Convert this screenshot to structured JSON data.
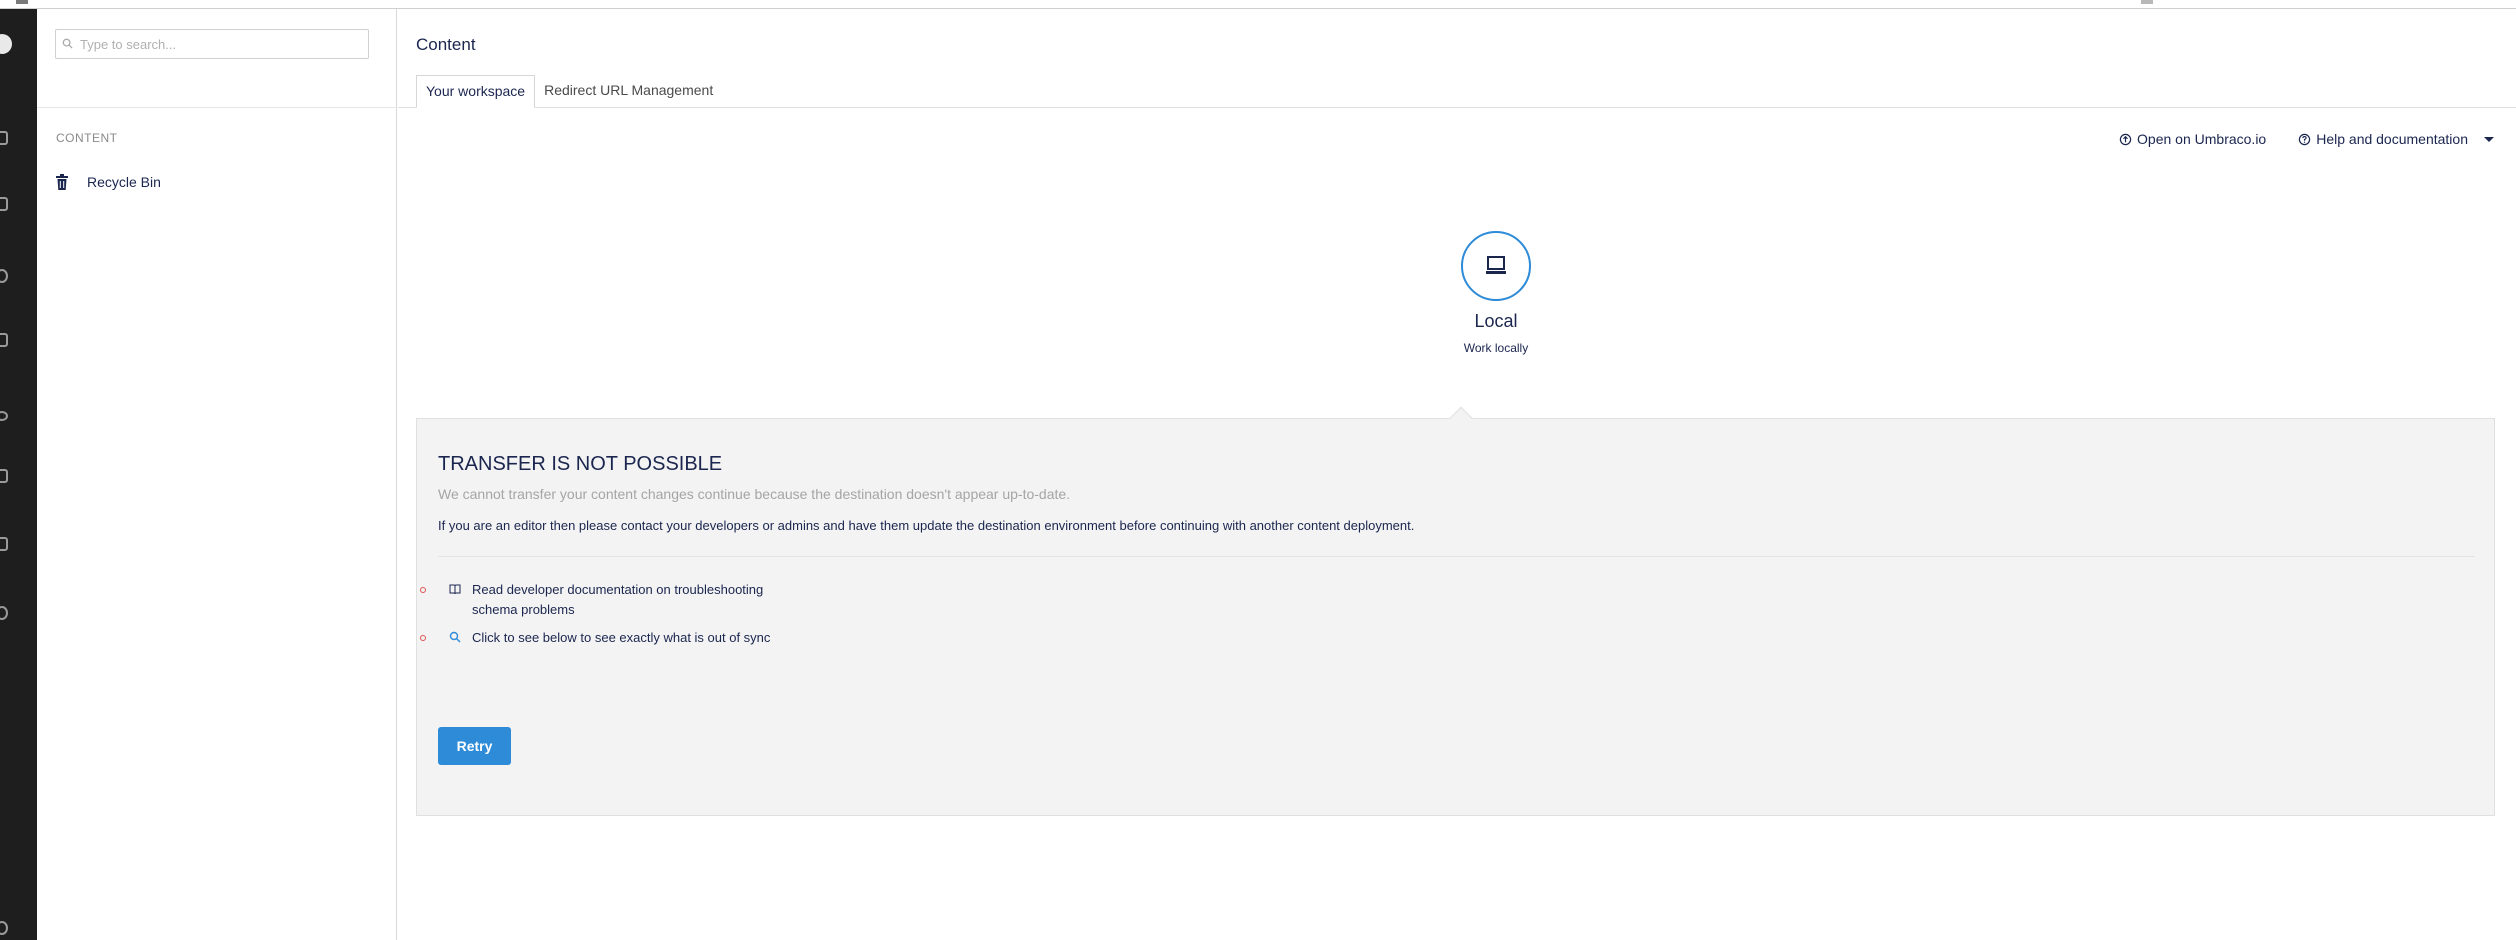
{
  "search": {
    "placeholder": "Type to search..."
  },
  "tree": {
    "section_header": "CONTENT",
    "items": [
      {
        "label": "Recycle Bin",
        "icon": "trash-icon"
      }
    ]
  },
  "header": {
    "title": "Content",
    "tabs": [
      {
        "label": "Your workspace",
        "active": true
      },
      {
        "label": "Redirect URL Management",
        "active": false
      }
    ]
  },
  "links": {
    "open_umbraco": "Open on Umbraco.io",
    "help": "Help and documentation"
  },
  "environment": {
    "name": "Local",
    "subtitle": "Work locally",
    "accent": "#2e8bd8"
  },
  "panel": {
    "title": "TRANSFER IS NOT POSSIBLE",
    "description": "We cannot transfer your content changes continue because the destination doesn't appear up-to-date.",
    "info": "If you are an editor then please contact your developers or admins and have them update the destination environment before continuing with another content deployment.",
    "items": [
      {
        "text": "Read developer documentation on troubleshooting schema problems",
        "icon": "book-icon"
      },
      {
        "text": "Click to see below to see exactly what is out of sync",
        "icon": "search-icon"
      }
    ],
    "retry_label": "Retry"
  },
  "colors": {
    "primary_button": "#2e8bd8",
    "bullet": "#d9534f",
    "rail": "#1e1e1e"
  }
}
